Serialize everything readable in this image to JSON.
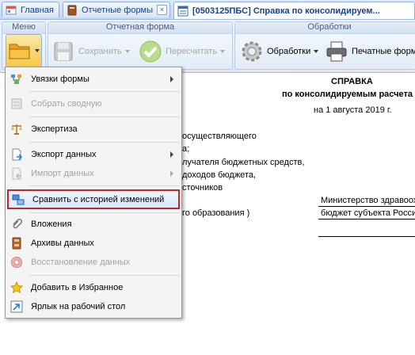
{
  "tabs": [
    {
      "label": "Главная",
      "icon": "home-icon"
    },
    {
      "label": "Отчетные формы",
      "icon": "book-icon"
    },
    {
      "label": "[0503125ПБС] Справка по консолидируем...",
      "icon": "form-icon"
    }
  ],
  "ribbon": {
    "menu_group": {
      "title": "Меню"
    },
    "report_group": {
      "title": "Отчетная форма",
      "save_label": "Сохранить",
      "recalc_label": "Пересчитать"
    },
    "processing_group": {
      "title": "Обработки",
      "processing_label": "Обработки",
      "print_label": "Печатные форм"
    }
  },
  "document": {
    "heading": "СПРАВКА",
    "subheading": "по консолидируемым расчета",
    "date_line": "на 1 августа 2019 г.",
    "lines": [
      "осуществляющего",
      "а;",
      "лучателя бюджетных средств,",
      "доходов бюджета,",
      "сточников",
      "го образования )"
    ],
    "fields": [
      "Министерство здравоохр",
      "бюджет субъекта Россиі"
    ]
  },
  "menu": {
    "items": [
      {
        "label": "Увязки формы",
        "icon": "links-icon",
        "disabled": false,
        "submenu": true
      },
      {
        "label": "Собрать сводную",
        "icon": "collect-icon",
        "disabled": true,
        "submenu": false
      },
      {
        "label": "Экспертиза",
        "icon": "scales-icon",
        "disabled": false,
        "submenu": false
      },
      {
        "label": "Экспорт данных",
        "icon": "export-icon",
        "disabled": false,
        "submenu": true
      },
      {
        "label": "Импорт данных",
        "icon": "import-icon",
        "disabled": true,
        "submenu": true
      },
      {
        "label": "Сравнить с историей изменений",
        "icon": "compare-icon",
        "disabled": false,
        "submenu": false,
        "highlighted": true
      },
      {
        "label": "Вложения",
        "icon": "paperclip-icon",
        "disabled": false,
        "submenu": false
      },
      {
        "label": "Архивы данных",
        "icon": "archive-icon",
        "disabled": false,
        "submenu": false
      },
      {
        "label": "Восстановление данных",
        "icon": "lifebuoy-icon",
        "disabled": true,
        "submenu": false
      },
      {
        "label": "Добавить в Избранное",
        "icon": "star-icon",
        "disabled": false,
        "submenu": false
      },
      {
        "label": "Ярлык на рабочий стол",
        "icon": "shortcut-icon",
        "disabled": false,
        "submenu": false
      }
    ]
  },
  "colors": {
    "highlight_border": "#c0262e",
    "tab_text": "#15428b",
    "disabled_text": "#a3a3a3"
  }
}
